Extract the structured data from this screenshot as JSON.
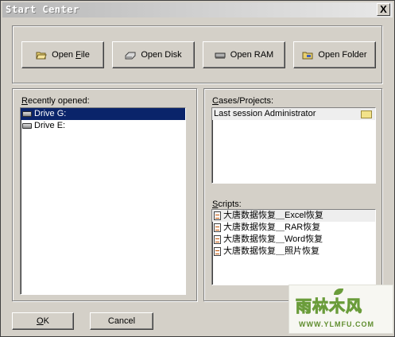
{
  "window": {
    "title": "Start Center",
    "close_label": "X"
  },
  "toolbar": {
    "buttons": [
      {
        "label_prefix": "Open ",
        "label_accel": "F",
        "label_suffix": "ile",
        "icon": "open-folder-icon"
      },
      {
        "label": "Open Disk",
        "icon": "disk-icon"
      },
      {
        "label": "Open RAM",
        "icon": "ram-icon"
      },
      {
        "label": "Open Folder",
        "icon": "folder-icon"
      }
    ]
  },
  "recent": {
    "label_accel": "R",
    "label_rest": "ecently opened:",
    "items": [
      {
        "label": "Drive G:",
        "selected": true,
        "icon": "drive-icon"
      },
      {
        "label": "Drive E:",
        "selected": false,
        "icon": "drive-icon"
      }
    ]
  },
  "cases": {
    "label_accel": "C",
    "label_rest": "ases/Projects:",
    "items": [
      {
        "label": "Last session Administrator",
        "icon": "folder-icon"
      }
    ]
  },
  "scripts": {
    "label_accel": "S",
    "label_rest": "cripts:",
    "items": [
      {
        "label": "大唐数据恢复＿Excel恢复",
        "icon": "script-icon"
      },
      {
        "label": "大唐数据恢复＿RAR恢复",
        "icon": "script-icon"
      },
      {
        "label": "大唐数据恢复＿Word恢复",
        "icon": "script-icon"
      },
      {
        "label": "大唐数据恢复＿照片恢复",
        "icon": "script-icon"
      }
    ]
  },
  "footer": {
    "ok_accel": "O",
    "ok_rest": "K",
    "cancel_label": "Cancel"
  },
  "watermark": {
    "text": "雨林木风",
    "url": "WWW.YLMFU.COM"
  }
}
